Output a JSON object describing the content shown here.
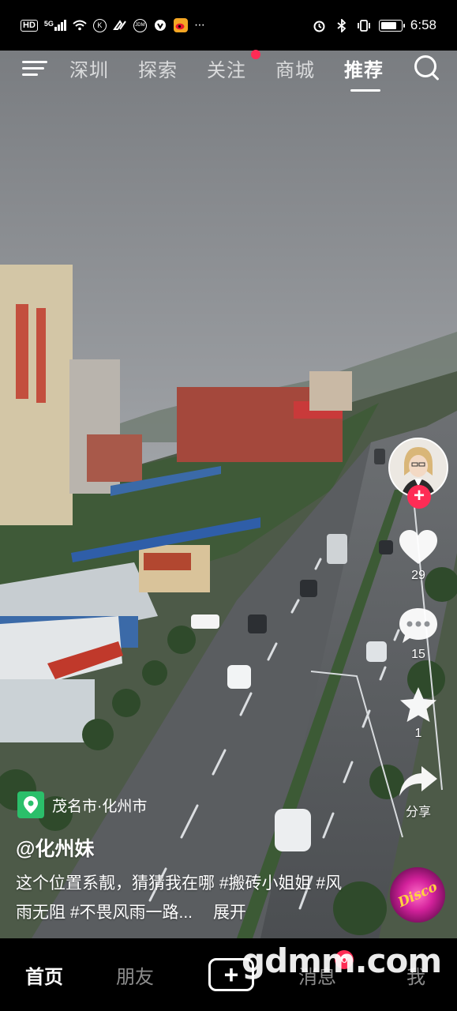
{
  "status_bar": {
    "network_badge": "HD",
    "signal_label": "5G",
    "app_icons": [
      "k-circle-icon",
      "link-icon",
      "jdm-icon",
      "shield-icon",
      "weibo-icon"
    ],
    "app_icon_texts": [
      "K",
      "JDM"
    ],
    "more": "···",
    "time": "6:58",
    "battery_level": 0.8
  },
  "top_nav": {
    "tabs": [
      {
        "label": "深圳",
        "active": false,
        "dot": false
      },
      {
        "label": "探索",
        "active": false,
        "dot": false
      },
      {
        "label": "关注",
        "active": false,
        "dot": true
      },
      {
        "label": "商城",
        "active": false,
        "dot": false
      },
      {
        "label": "推荐",
        "active": true,
        "dot": false
      }
    ]
  },
  "actions": {
    "likes": "29",
    "comments": "15",
    "favorites": "1",
    "share_label": "分享",
    "follow_symbol": "+"
  },
  "caption": {
    "location": "茂名市·化州市",
    "author": "@化州妹",
    "description": "这个位置系靓，猜猜我在哪 #搬砖小姐姐 #风雨无阻 #不畏风雨一路...",
    "expand": "展开",
    "music_disc_text": "Disco"
  },
  "bottom_nav": {
    "home": "首页",
    "friends": "朋友",
    "add_symbol": "+",
    "messages": "消息",
    "messages_badge": "6",
    "me": "我"
  },
  "watermark": "gdmm.com",
  "colors": {
    "accent": "#fe2c55",
    "location_pin": "#2bbf6a",
    "sky": "#8f9296"
  }
}
